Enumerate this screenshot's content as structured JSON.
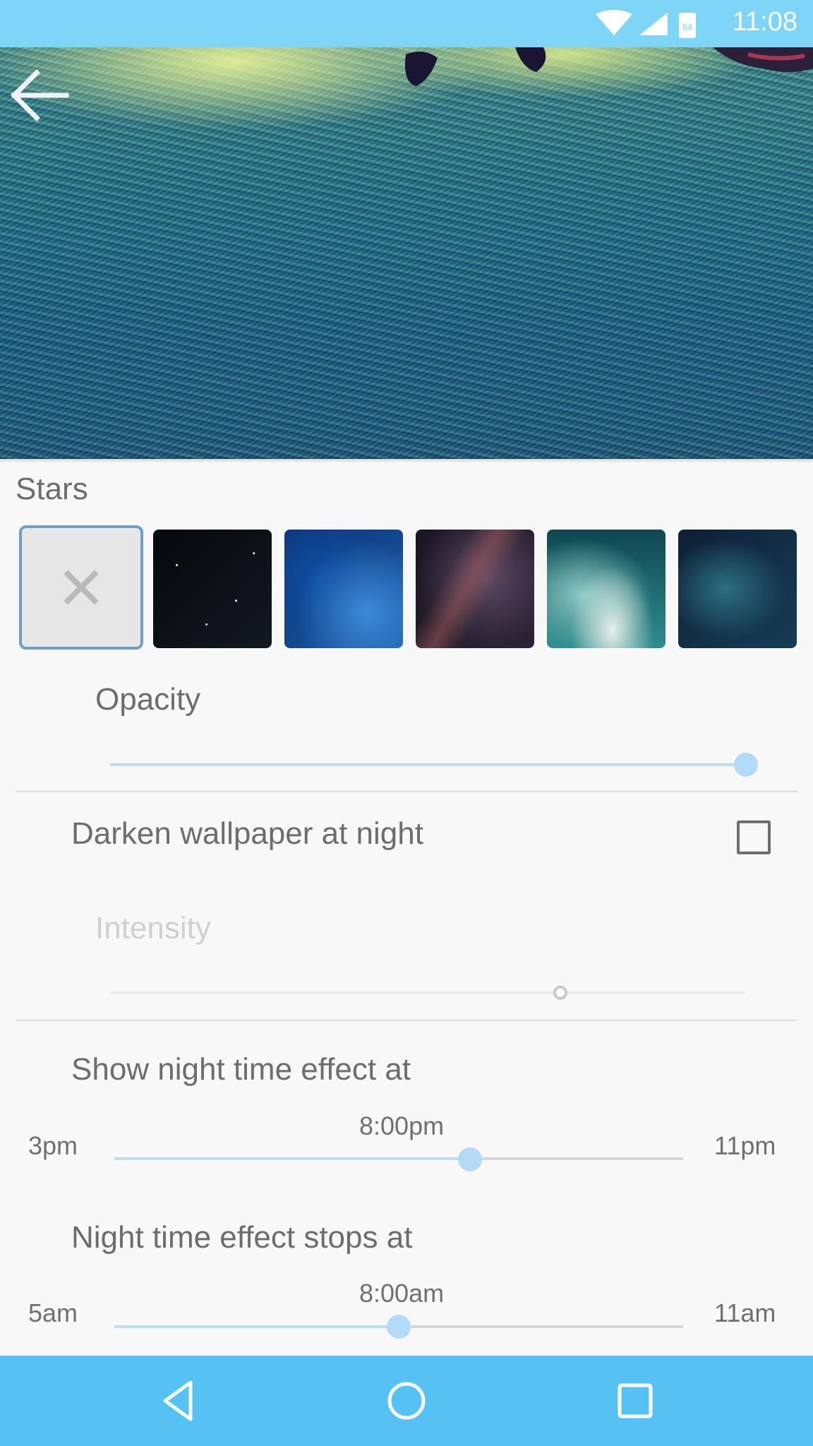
{
  "status_bar": {
    "time": "11:08",
    "battery_level": "84"
  },
  "header": {
    "back_icon": "arrow-back-icon"
  },
  "stars": {
    "title": "Stars",
    "options": [
      {
        "name": "none",
        "selected": true
      },
      {
        "name": "black-starfield"
      },
      {
        "name": "blue-nebula"
      },
      {
        "name": "purple-milky-way"
      },
      {
        "name": "teal-clouds"
      },
      {
        "name": "dark-blue-nebula"
      }
    ]
  },
  "opacity": {
    "label": "Opacity",
    "value_fraction": 1.0
  },
  "darken": {
    "label": "Darken wallpaper at night",
    "checked": false
  },
  "intensity": {
    "label": "Intensity",
    "value_fraction": 0.71,
    "enabled": false
  },
  "night_start": {
    "label": "Show night time effect at",
    "min_label": "3pm",
    "max_label": "11pm",
    "value_label": "8:00pm",
    "value_fraction": 0.625
  },
  "night_stop": {
    "label": "Night time effect stops at",
    "min_label": "5am",
    "max_label": "11am",
    "value_label": "8:00am",
    "value_fraction": 0.5
  },
  "nav": {
    "back_icon": "nav-back-icon",
    "home_icon": "nav-home-icon",
    "recents_icon": "nav-recents-icon"
  },
  "colors": {
    "accent": "#b3daf6",
    "status_bar": "#7fd5f7",
    "nav_bar": "#55c2f3",
    "selected_border": "#6f9ec6"
  }
}
